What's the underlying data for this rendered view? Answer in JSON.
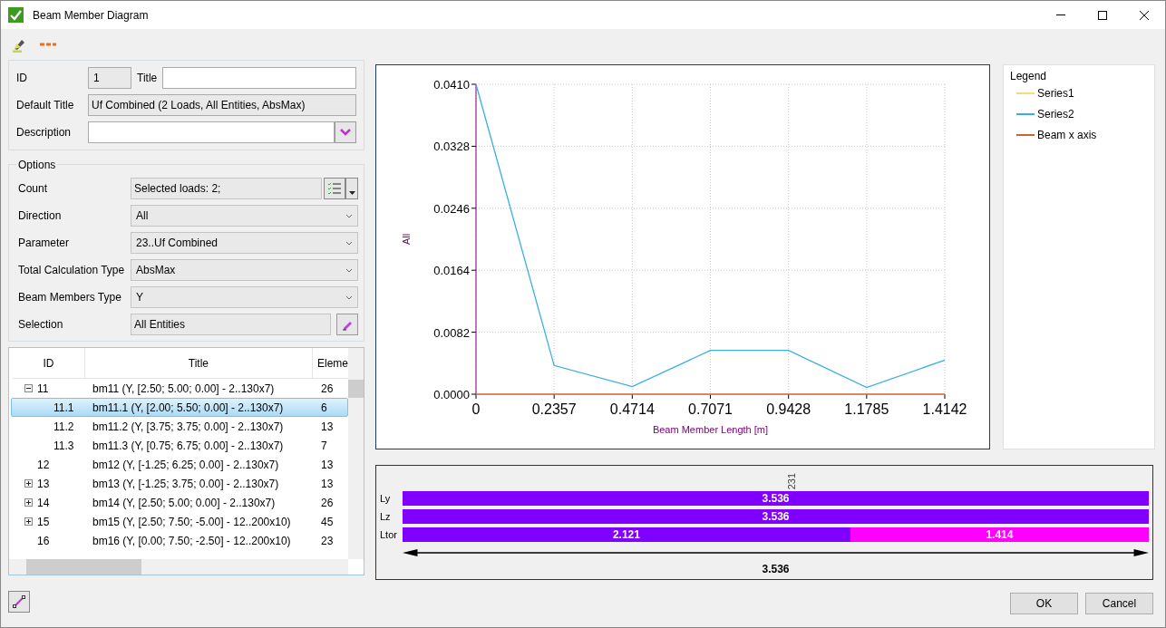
{
  "window": {
    "title": "Beam Member Diagram",
    "buttons": [
      "OK",
      "Cancel"
    ]
  },
  "form": {
    "id_label": "ID",
    "id_value": "1",
    "title_label": "Title",
    "default_title_label": "Default Title",
    "default_title_value": "Uf Combined (2 Loads, All Entities, AbsMax)",
    "description_label": "Description"
  },
  "options": {
    "legend": "Options",
    "rows": [
      {
        "kind": "loads",
        "label": "Count",
        "value": "Selected loads: 2;"
      },
      {
        "kind": "dropdown",
        "label": "Direction",
        "value": "All"
      },
      {
        "kind": "dropdown",
        "label": "Parameter",
        "value": "23..Uf Combined"
      },
      {
        "kind": "dropdown",
        "label": "Total Calculation Type",
        "value": "AbsMax"
      },
      {
        "kind": "dropdown",
        "label": "Beam Members Type",
        "value": "Y"
      },
      {
        "kind": "pick",
        "label": "Selection",
        "value": "All Entities"
      }
    ]
  },
  "table": {
    "columns": [
      "ID",
      "Title",
      "Eleme"
    ],
    "rows": [
      {
        "kind": "group",
        "expanded": true,
        "selected": false,
        "id": "11",
        "title": "bm11 (Y, [2.50; 5.00; 0.00] - 2..130x7)",
        "elements": "26",
        "children": [
          {
            "selected": true,
            "id": "11.1",
            "title": "bm11.1 (Y, [2.00; 5.50; 0.00] - 2..130x7)",
            "elements": "6"
          },
          {
            "selected": false,
            "id": "11.2",
            "title": "bm11.2 (Y, [3.75; 3.75; 0.00] - 2..130x7)",
            "elements": "13"
          },
          {
            "selected": false,
            "id": "11.3",
            "title": "bm11.3 (Y, [0.75; 6.75; 0.00] - 2..130x7)",
            "elements": "7"
          }
        ]
      },
      {
        "kind": "item",
        "selected": false,
        "id": "12",
        "title": "bm12 (Y, [-1.25; 6.25; 0.00] - 2..130x7)",
        "elements": "13"
      },
      {
        "kind": "group",
        "expanded": false,
        "selected": false,
        "id": "13",
        "title": "bm13 (Y, [-1.25; 3.75; 0.00] - 2..130x7)",
        "elements": "13"
      },
      {
        "kind": "group",
        "expanded": false,
        "selected": false,
        "id": "14",
        "title": "bm14 (Y, [2.50; 5.00; 0.00] - 2..130x7)",
        "elements": "26"
      },
      {
        "kind": "group",
        "expanded": false,
        "selected": false,
        "id": "15",
        "title": "bm15 (Y, [2.50; 7.50; -5.00] - 12..200x10)",
        "elements": "45"
      },
      {
        "kind": "item",
        "selected": false,
        "id": "16",
        "title": "bm16 (Y, [0.00; 7.50; -2.50] - 12..200x10)",
        "elements": "23"
      }
    ]
  },
  "chart": {
    "chart_data": {
      "type": "line",
      "grid": true,
      "xlabel": "Beam Member Length [m]",
      "ylabel": "All",
      "x": [
        0,
        0.2357,
        0.4714,
        0.7071,
        0.9428,
        1.1785,
        1.4142
      ],
      "series": [
        {
          "name": "Series1",
          "color": "#f5dc78",
          "values": [
            null,
            null,
            null,
            null,
            null,
            null,
            null
          ]
        },
        {
          "name": "Series2",
          "color": "#3aaee0",
          "values": [
            0.041,
            0.0038,
            0.001,
            0.0058,
            0.0058,
            0.0009,
            0.0045
          ]
        },
        {
          "name": "Beam x axis",
          "color": "#c8643c",
          "values": [
            0,
            0,
            0,
            0,
            0,
            0,
            0
          ]
        }
      ],
      "xlim": [
        0,
        1.4142
      ],
      "ylim": [
        0,
        0.041
      ],
      "xticks": [
        {
          "value": 0,
          "label": "0"
        },
        {
          "value": 0.2357,
          "label": "0.2357"
        },
        {
          "value": 0.4714,
          "label": "0.4714"
        },
        {
          "value": 0.7071,
          "label": "0.7071"
        },
        {
          "value": 0.9428,
          "label": "0.9428"
        },
        {
          "value": 1.1785,
          "label": "1.1785"
        },
        {
          "value": 1.4142,
          "label": "1.4142"
        }
      ],
      "yticks": [
        {
          "value": 0,
          "label": "0.0000"
        },
        {
          "value": 0.0082,
          "label": "0.0082"
        },
        {
          "value": 0.0164,
          "label": "0.0164"
        },
        {
          "value": 0.0246,
          "label": "0.0246"
        },
        {
          "value": 0.0328,
          "label": "0.0328"
        },
        {
          "value": 0.041,
          "label": "0.0410"
        }
      ]
    }
  },
  "legend": {
    "title": "Legend"
  },
  "lengths": {
    "marker": "231",
    "total": "3.536",
    "rows": [
      {
        "label": "Ly",
        "segments": [
          {
            "value": "3.536",
            "level": 1,
            "color": "#8000ff"
          }
        ]
      },
      {
        "label": "Lz",
        "segments": [
          {
            "value": "3.536",
            "level": 1,
            "color": "#8000ff"
          }
        ]
      },
      {
        "label": "Ltor",
        "segments": [
          {
            "value": "2.121",
            "level": 0.6,
            "color": "#8000ff"
          },
          {
            "value": "1.414",
            "level": 0.4,
            "color": "#ff00ff"
          }
        ]
      }
    ]
  }
}
